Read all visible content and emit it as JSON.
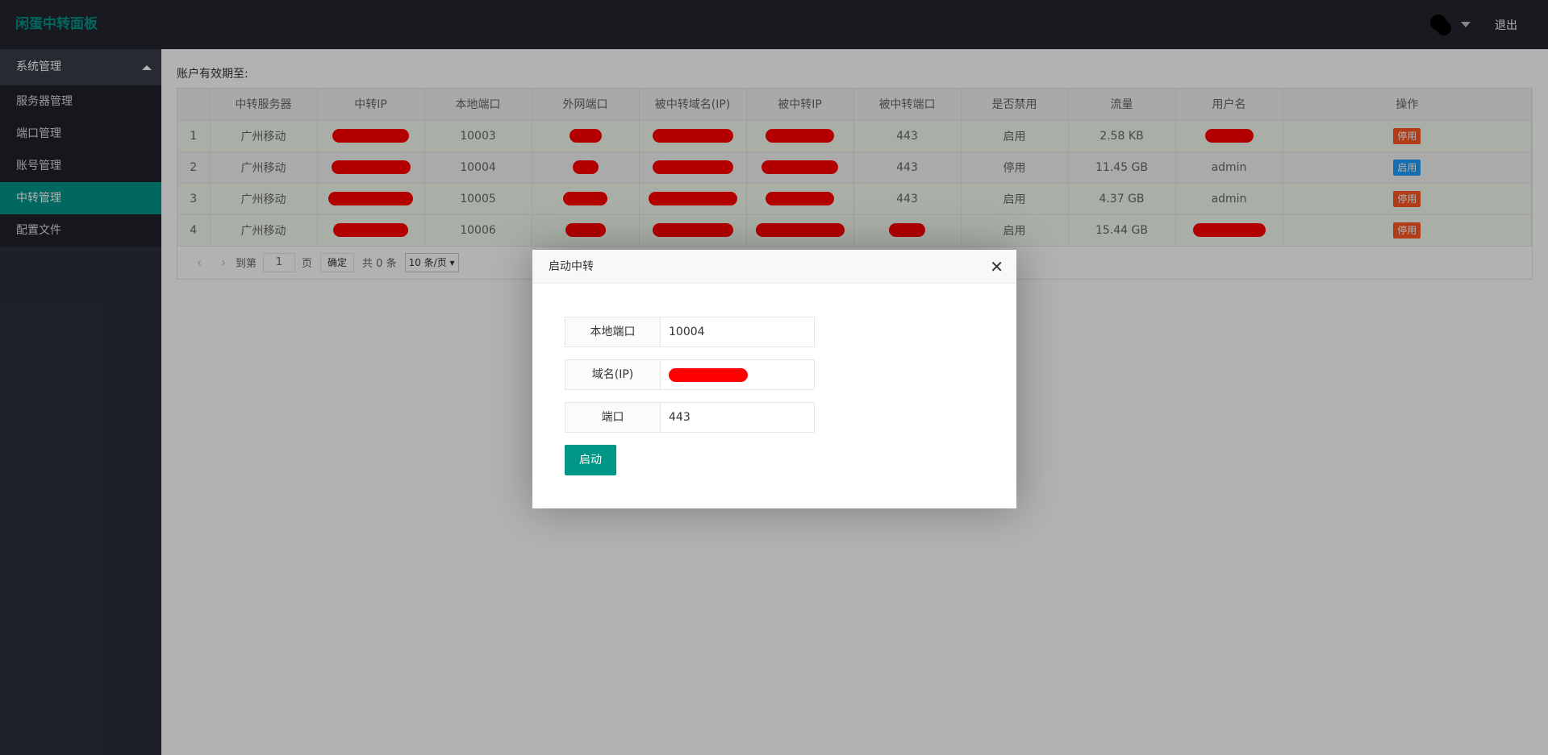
{
  "header": {
    "logo": "闲蛋中转面板",
    "logout": "退出",
    "avatar_icon": "avatar-icon",
    "dropdown_icon": "caret-down-icon"
  },
  "sidebar": {
    "group": "系统管理",
    "items": [
      {
        "label": "服务器管理",
        "active": false
      },
      {
        "label": "端口管理",
        "active": false
      },
      {
        "label": "账号管理",
        "active": false
      },
      {
        "label": "中转管理",
        "active": true
      },
      {
        "label": "配置文件",
        "active": false
      }
    ]
  },
  "main": {
    "expire_label": "账户有效期至:",
    "table": {
      "columns": [
        "",
        "中转服务器",
        "中转IP",
        "本地端口",
        "外网端口",
        "被中转域名(IP)",
        "被中转IP",
        "被中转端口",
        "是否禁用",
        "流量",
        "用户名",
        "操作"
      ],
      "rows": [
        {
          "idx": "1",
          "server": "广州移动",
          "local_port": "10003",
          "dst_port": "443",
          "disabled": "启用",
          "traffic": "2.58 KB",
          "user": "",
          "action": "停用",
          "action_color": "#ff5722"
        },
        {
          "idx": "2",
          "server": "广州移动",
          "local_port": "10004",
          "dst_port": "443",
          "disabled": "停用",
          "traffic": "11.45 GB",
          "user": "admin",
          "action": "启用",
          "action_color": "#1e9fff"
        },
        {
          "idx": "3",
          "server": "广州移动",
          "local_port": "10005",
          "dst_port": "443",
          "disabled": "启用",
          "traffic": "4.37 GB",
          "user": "admin",
          "action": "停用",
          "action_color": "#ff5722"
        },
        {
          "idx": "4",
          "server": "广州移动",
          "local_port": "10006",
          "dst_port": "",
          "disabled": "启用",
          "traffic": "15.44 GB",
          "user": "",
          "action": "停用",
          "action_color": "#ff5722"
        }
      ]
    },
    "pager": {
      "goto": "到第",
      "page_value": "1",
      "page_unit": "页",
      "confirm": "确定",
      "total": "共 0 条",
      "page_size": "10 条/页"
    }
  },
  "modal": {
    "title": "启动中转",
    "fields": [
      {
        "label": "本地端口",
        "value": "10004"
      },
      {
        "label": "域名(IP)",
        "value": ""
      },
      {
        "label": "端口",
        "value": "443"
      }
    ],
    "submit": "启动"
  },
  "colors": {
    "brand": "#009688",
    "header_bg": "#23262e",
    "sidebar_bg": "#2b2f3a",
    "redaction": "#ff0000"
  }
}
